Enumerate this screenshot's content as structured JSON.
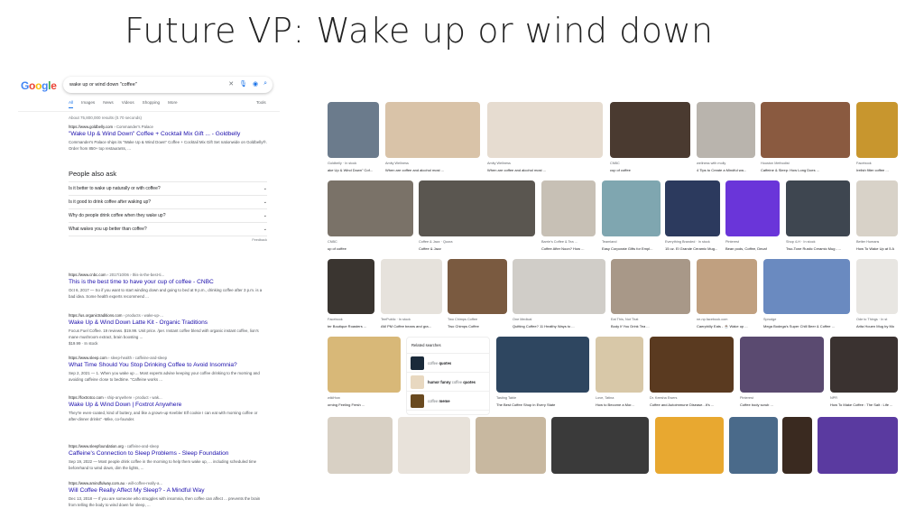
{
  "slide_title": "Future VP: Wake up or wind down",
  "google": {
    "logo": "Google",
    "query": "wake up or wind down \"coffee\"",
    "tabs": [
      "All",
      "Images",
      "News",
      "Videos",
      "Shopping",
      "More"
    ],
    "tools": "Tools",
    "stats": "About 75,800,000 results (0.70 seconds)",
    "results": [
      {
        "domain": "https://www.goldbelly.com",
        "path": " › Commander's Palace",
        "title": "\"Wake Up & Wind Down\" Coffee + Cocktail Mix Gift ... - Goldbelly",
        "snippet": "Commander's Palace ships its \"Wake Up & Wind Down\" Coffee + Cocktail Mix Gift Set nationwide on Goldbelly®. Order from 850+ top restaurants, ..."
      },
      {
        "domain": "https://www.cnbc.com",
        "path": " › 2017/10/06 › this-is-the-best-ti...",
        "title": "This is the best time to have your cup of coffee - CNBC",
        "snippet": "Oct 6, 2017 — So if you want to start winding down and going to bed at 9 p.m., drinking coffee after 3 p.m. is a bad idea. Some health experts recommend ..."
      },
      {
        "domain": "https://us.organictraditions.com",
        "path": " › products › wake-up-...",
        "title": "Wake Up & Wind Down Latte Kit - Organic Traditions",
        "snippet": "Focus Fuel Coffee. 19 reviews. $19.99. Unit price. /per. Instant coffee blend with organic instant coffee, lion's mane mushroom extract, brain boosting ...",
        "extra": "$19.99 · In stock"
      },
      {
        "domain": "https://www.sleep.com",
        "path": " › sleep-health › caffeine-and-sleep",
        "title": "What Time Should You Stop Drinking Coffee to Avoid Insomnia?",
        "snippet": "Sep 2, 2021 — 1. When you wake up ... Most experts advise keeping your coffee drinking to the morning and avoiding caffeine close to bedtime. \"Caffeine works ..."
      },
      {
        "domain": "https://foxtrotco.com",
        "path": " › ship-anywhere › product › wak...",
        "title": "Wake Up & Wind Down | Foxtrot Anywhere",
        "snippet": "They're even-coated, kind of buttery, and like a grown-up Keebler Elf cookie I can eat with morning coffee or after-dinner drinks\" -Mike, co-founder."
      },
      {
        "domain": "https://www.sleepfoundation.org",
        "path": " › caffeine-and-sleep",
        "title": "Caffeine's Connection to Sleep Problems - Sleep Foundation",
        "snippet": "Sep 19, 2022 — Most people drink coffee in the morning to help them wake up, ... including scheduled time beforehand to wind down, dim the lights, ..."
      },
      {
        "domain": "https://www.amindfulway.com.au",
        "path": " › will-coffee-really-a...",
        "title": "Will Coffee Really Affect My Sleep? - A Mindful Way",
        "snippet": "Dec 13, 2018 — If you are someone who struggles with insomnia, then coffee can affect ... prevents the brain from telling the body to wind down for sleep, ..."
      }
    ],
    "people_also_ask": {
      "heading": "People also ask",
      "questions": [
        "Is it better to wake up naturally or with coffee?",
        "Is it good to drink coffee after waking up?",
        "Why do people drink coffee when they wake up?",
        "What wakes you up better than coffee?"
      ],
      "feedback": "Feedback"
    }
  },
  "images": {
    "rows": [
      [
        {
          "src": "Goldbelly · In stock",
          "cap": "ake Up & Wind Down\" Cof...",
          "color": "#6b7b8c"
        },
        {
          "src": "Amity Wellness",
          "cap": "When are coffee and alcohol most ...",
          "color": "#d9c3a8"
        },
        {
          "src": "Amity Wellness",
          "cap": "When are coffee and alcohol most ...",
          "color": "#e6dcd0"
        },
        {
          "src": "CNBC",
          "cap": "cup of coffee",
          "color": "#4a3a30"
        },
        {
          "src": "wellness with molly",
          "cap": "4 Tips to Create a Mindful wa...",
          "color": "#b9b4ad"
        },
        {
          "src": "Houston Methodist",
          "cap": "Caffeine & Sleep: How Long Does ...",
          "color": "#8a5a40"
        },
        {
          "src": "Facebook",
          "cap": "Irelish filter coffee ...",
          "color": "#c8962e"
        }
      ],
      [
        {
          "src": "CNBC",
          "cap": "up of coffee",
          "color": "#7a7268"
        },
        {
          "src": "Coffee & Jazz · Quora",
          "cap": "Coffee & Jazz",
          "color": "#5a5650"
        },
        {
          "src": "Barrie's Coffee & Tea ...",
          "cap": "Coffee After Noon? How ...",
          "color": "#c7c0b5"
        },
        {
          "src": "Teamland",
          "cap": "Easy Corporate Gifts for Empl...",
          "color": "#7fa6b0"
        },
        {
          "src": "Everything Branded · In stock",
          "cap": "15 oz. El Grande Ceramic Mug...",
          "color": "#2c3a5e"
        },
        {
          "src": "Pinterest",
          "cap": "Bean pods, Coffee, Decaf",
          "color": "#6a35d9"
        },
        {
          "src": "Shop 4-H · In stock",
          "cap": "Two-Tone Rustic Ceramic Mug - ...",
          "color": "#3e4650"
        },
        {
          "src": "Better Humans",
          "cap": "How To Wake Up at 5 A",
          "color": "#d8d2c8"
        }
      ],
      [
        {
          "src": "Facebook",
          "cap": "ter Boutique Roasters ...",
          "color": "#3a3530"
        },
        {
          "src": "TeePublic · In stock",
          "cap": "AM PM Coffee beans and gra...",
          "color": "#e6e2dc"
        },
        {
          "src": "Two Chimps Coffee",
          "cap": "Two Chimps Coffee",
          "color": "#7a5a40"
        },
        {
          "src": "One Medical",
          "cap": "Quitting Coffee? 11 Healthy Ways to ...",
          "color": "#d0cdc8"
        },
        {
          "src": "Eat This, Not That",
          "cap": "Body If You Drink Tea ...",
          "color": "#a89888"
        },
        {
          "src": "ne-np.facebook.com",
          "cap": "Caerphilly Eats - ☕ Wake up ...",
          "color": "#c0a080"
        },
        {
          "src": "Sprudge",
          "cap": "Mega Bodega's Super Chill Beer & Coffee ...",
          "color": "#6a8ac0"
        },
        {
          "src": "Ode to Things · In st",
          "cap": "Arita Houen Mug by Mo",
          "color": "#e8e6e2"
        }
      ],
      [
        {
          "src": "wikiHow",
          "cap": "orning Feeling Fresh ...",
          "color": "#d8b878"
        },
        {
          "src": "Tasting Table",
          "cap": "The Best Coffee Shop in Every State",
          "color": "#2e4660"
        },
        {
          "src": "Love, Tatina",
          "cap": "How to Become a Mor...",
          "color": "#d8c8a8"
        },
        {
          "src": "Dr. Keesha Ewers",
          "cap": "Coffee and Autoimmune Disease...It's ...",
          "color": "#5a3a20"
        },
        {
          "src": "Pinterest",
          "cap": "Coffee body scrub ...",
          "color": "#5a4a70"
        },
        {
          "src": "NPR",
          "cap": "How To Make Coffee : The Salt : Life ...",
          "color": "#3a3230"
        }
      ],
      [
        {
          "color": "#d8d0c4"
        },
        {
          "color": "#e8e2da"
        },
        {
          "color": "#c8b8a0"
        },
        {
          "color": "#3a3a3a"
        },
        {
          "color": "#e8a830"
        },
        {
          "color": "#4a6a8a"
        },
        {
          "color": "#3a2a20"
        },
        {
          "color": "#5a3aa0"
        }
      ]
    ],
    "related": {
      "heading": "Related searches",
      "items": [
        {
          "pre": "coffee ",
          "bold": "quotes",
          "color": "#1a2a3a"
        },
        {
          "pre": "humor funny ",
          "mid": "coffee ",
          "bold": "quotes",
          "color": "#e8d8c0",
          "boldfirst": true
        },
        {
          "pre": "coffee ",
          "bold": "meme",
          "color": "#6a4a20"
        }
      ]
    }
  }
}
